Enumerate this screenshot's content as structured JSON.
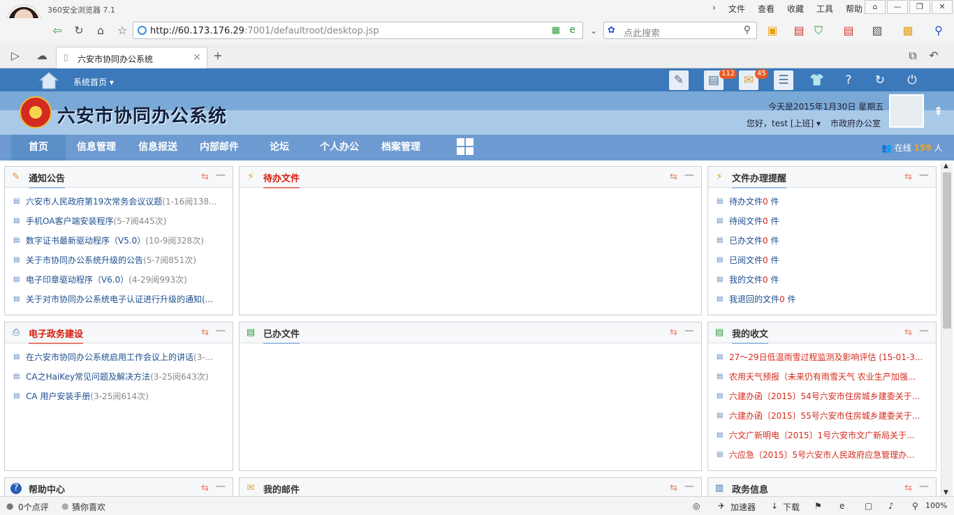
{
  "browser": {
    "app_name": "360安全浏览器 7.1",
    "menu": [
      "文件",
      "查看",
      "收藏",
      "工具",
      "帮助"
    ],
    "window_controls": [
      "⌂",
      "—",
      "❐",
      "✕"
    ],
    "address_host": "http://60.173.176.29",
    "address_rest": ":7001/defaultroot/desktop.jsp",
    "search_placeholder": "点此搜索",
    "tab_title": "六安市协同办公系统"
  },
  "header": {
    "sys_home": "系统首页",
    "system_name": "六安市协同办公系统",
    "today": "今天是2015年1月30日 星期五",
    "hello": "您好，test [上班]",
    "department": "市政府办公室",
    "badges": {
      "todo": "112",
      "mail": "45"
    },
    "online_prefix": "在线",
    "online_count": "159",
    "online_suffix": "人"
  },
  "main_nav": [
    "首页",
    "信息管理",
    "信息报送",
    "内部邮件",
    "论坛",
    "个人办公",
    "档案管理"
  ],
  "panels": {
    "notice": {
      "title": "通知公告",
      "items": [
        {
          "text": "六安市人民政府第19次常务会议议题",
          "meta": "(1-16阅138..."
        },
        {
          "text": "手机OA客户端安装程序",
          "meta": "(5-7阅445次)"
        },
        {
          "text": "数字证书最新驱动程序（V5.0）",
          "meta": "(10-9阅328次)"
        },
        {
          "text": "关于市协同办公系统升级的公告",
          "meta": "(5-7阅851次)"
        },
        {
          "text": "电子印章驱动程序（V6.0）",
          "meta": "(4-29阅993次)"
        },
        {
          "text": "关于对市协同办公系统电子认证进行升级的通知(...",
          "meta": ""
        }
      ]
    },
    "todo": {
      "title": "待办文件"
    },
    "reminder": {
      "title": "文件办理提醒",
      "items": [
        {
          "label": "待办文件",
          "count": "0",
          "unit": " 件"
        },
        {
          "label": "待阅文件",
          "count": "0",
          "unit": " 件"
        },
        {
          "label": "已办文件",
          "count": "0",
          "unit": " 件"
        },
        {
          "label": "已阅文件",
          "count": "0",
          "unit": " 件"
        },
        {
          "label": "我的文件",
          "count": "0",
          "unit": " 件"
        },
        {
          "label": "我退回的文件",
          "count": "0",
          "unit": " 件"
        }
      ]
    },
    "egov": {
      "title": "电子政务建设",
      "items": [
        {
          "text": "在六安市协同办公系统启用工作会议上的讲话",
          "meta": "(3-..."
        },
        {
          "text": "CA之HaiKey常见问题及解决方法",
          "meta": "(3-25阅643次)"
        },
        {
          "text": "CA 用户安装手册",
          "meta": "(3-25阅614次)"
        }
      ]
    },
    "done": {
      "title": "已办文件"
    },
    "received": {
      "title": "我的收文",
      "items": [
        "27～29日低温雨雪过程监测及影响评估 (15-01-3...",
        "农用天气预报（未来仍有雨雪天气 农业生产加强...",
        "六建办函〔2015〕54号六安市住房城乡建委关于...",
        "六建办函〔2015〕55号六安市住房城乡建委关于...",
        "六文广新明电〔2015〕1号六安市文广新局关于...",
        "六应急〔2015〕5号六安市人民政府应急管理办..."
      ]
    },
    "help": {
      "title": "帮助中心"
    },
    "mymail": {
      "title": "我的邮件"
    },
    "govinfo": {
      "title": "政务信息"
    }
  },
  "statusbar": {
    "comments": "0个点评",
    "guess": "猜你喜欢",
    "accelerator": "加速器",
    "download": "下载",
    "zoom": "100%"
  }
}
